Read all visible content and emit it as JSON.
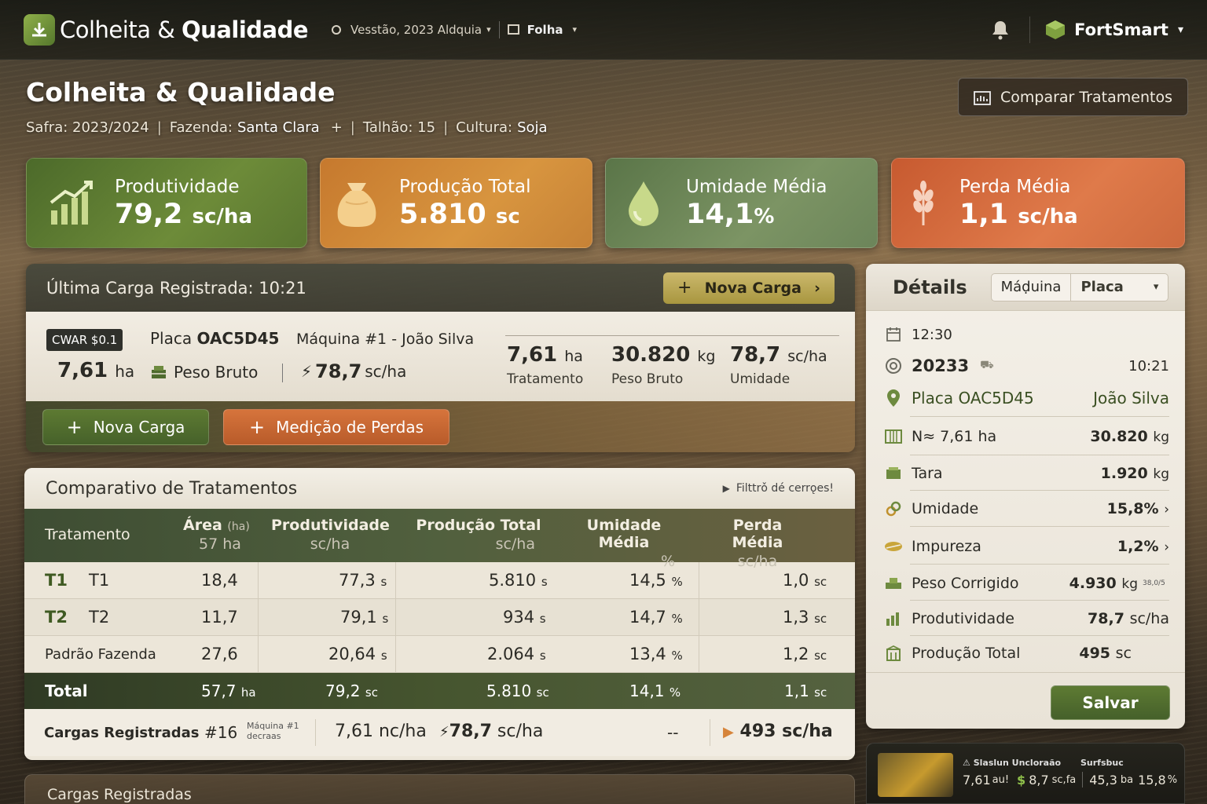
{
  "topbar": {
    "brand_light": "Colheita &",
    "brand_bold": "Qualidade",
    "version_label": "Vesstão, 2023 Aldquia",
    "view_label": "Folha",
    "user_brand": "FortSmart"
  },
  "header": {
    "title": "Colheita & Qualidade",
    "safra_label": "Safra: 2023/2024",
    "fazenda_label": "Fazenda:",
    "fazenda_value": "Santa Clara",
    "fazenda_add": "+",
    "talhao_label": "Talhão: 15",
    "cultura_label": "Cultura:",
    "cultura_value": "Soja",
    "compare_button": "Comparar Tratamentos"
  },
  "kpis": [
    {
      "label": "Produtividade",
      "value": "79,2",
      "unit": "sc/ha",
      "color": "#5e7c31"
    },
    {
      "label": "Produção Total",
      "value": "5.810",
      "unit": "sc",
      "color": "#d08a38"
    },
    {
      "label": "Umidade Média",
      "value": "14,1",
      "unit": "%",
      "color": "#6d8758"
    },
    {
      "label": "Perda Média",
      "value": "1,1",
      "unit": "sc/ha",
      "color": "#d76a3d"
    }
  ],
  "last_load": {
    "title": "Última Carga Registrada: 10:21",
    "new_load_button": "Nova Carga",
    "badge": "CWAR $0.1",
    "placa_label": "Placa",
    "placa_value": "OAC5D45",
    "machine": "Máquina #1 - João Silva",
    "area_value": "7,61",
    "area_unit": "ha",
    "peso_bruto_label": "Peso Bruto",
    "prod_value": "78,7",
    "prod_unit": "sc/ha",
    "stats": [
      {
        "value": "7,61",
        "unit": "ha",
        "label": "Tratamento"
      },
      {
        "value": "30.820",
        "unit": "kg",
        "label": "Peso Bruto"
      },
      {
        "value": "78,7",
        "unit": "sc/ha",
        "label": "Umidade"
      }
    ],
    "btn_nova_carga": "Nova Carga",
    "btn_medicao": "Medição de Perdas"
  },
  "comparison": {
    "title": "Comparativo de Tratamentos",
    "filter_label": "Filttrǒ dé cerrǫes!",
    "headers": {
      "tratamento": "Tratamento",
      "area": "Área",
      "area_unit": "(ha)",
      "area_sub": "57 ha",
      "produtividade": "Produtividade",
      "produtividade_sub": "sc/ha",
      "producao": "Produção Total",
      "producao_sub": "sc/ha",
      "umidade": "Umidade Média",
      "umidade_sub": "%",
      "perda": "Perda Média",
      "perda_sub": "sc/ha"
    },
    "rows": [
      {
        "code": "T1",
        "name": "T1",
        "area": "18,4",
        "prod": "77,3",
        "prod_u": "s",
        "total": "5.810",
        "total_u": "s",
        "umid": "14,5",
        "perda": "1,0"
      },
      {
        "code": "T2",
        "name": "T2",
        "area": "11,7",
        "prod": "79,1",
        "prod_u": "s",
        "total": "934",
        "total_u": "s",
        "umid": "14,7",
        "perda": "1,3"
      },
      {
        "code": "",
        "name": "Padrão Fazenda",
        "area": "27,6",
        "prod": "20,64",
        "prod_u": "s",
        "total": "2.064",
        "total_u": "s",
        "umid": "13,4",
        "perda": "1,2"
      }
    ],
    "pct": "%",
    "sc": "sc",
    "total": {
      "label": "Total",
      "area": "57,7",
      "area_u": "ha",
      "prod": "79,2",
      "prod_u": "sc",
      "total": "5.810",
      "total_u": "sc",
      "umid": "14,1",
      "umid_u": "%",
      "perda": "1,1",
      "perda_u": "sc"
    },
    "cargas": {
      "label": "Cargas Registradas",
      "count": "#16",
      "machine_line1": "Máquina #1",
      "machine_line2": "decraas",
      "area": "7,61",
      "area_u": "nc/ha",
      "prod": "78,7",
      "prod_u": "sc/ha",
      "dash": "--",
      "result": "493 sc/ha"
    }
  },
  "cargas_strip": {
    "title": "Cargas Registradas"
  },
  "details": {
    "title": "Détails",
    "tab_machine": "Máḍuina",
    "tab_placa": "Placa",
    "time": "12:30",
    "id": "20233",
    "id_time": "10:21",
    "placa": "Placa OAC5D45",
    "operator": "João Silva",
    "rows": [
      {
        "label": "N≈ 7,61 ha",
        "value": "30.820",
        "unit": "kg",
        "icon": "grid-icon"
      },
      {
        "label": "Tara",
        "value": "1.920",
        "unit": "kg",
        "icon": "scale-icon"
      },
      {
        "label": "Umidade",
        "value": "15,8%",
        "unit": "›",
        "icon": "link-icon"
      },
      {
        "label": "Impureza",
        "value": "1,2%",
        "unit": "›",
        "icon": "leaf-icon"
      },
      {
        "label": "Peso Corrigido",
        "value": "4.930",
        "unit": "kg",
        "icon": "weight-icon"
      },
      {
        "label": "Produtividade",
        "value": "78,7",
        "unit": "sc/ha",
        "icon": "chart-icon"
      },
      {
        "label": "Produção Total",
        "value": "495",
        "unit": "sc",
        "icon": "silo-icon"
      }
    ],
    "corr_note": "38,0/5",
    "save_button": "Salvar"
  },
  "mini": {
    "title1": "Slaslun Uncloraão",
    "title2": "Surfsbuc",
    "v1": "7,61",
    "v1u": "au!",
    "v2": "8,7",
    "v2u": "sc,fa",
    "v3": "45,3",
    "v3u": "ba",
    "v4": "15,8",
    "v4u": "%"
  },
  "colors": {
    "accent_green": "#5e7c31",
    "accent_orange": "#d08a38",
    "accent_red": "#d76a3d"
  }
}
